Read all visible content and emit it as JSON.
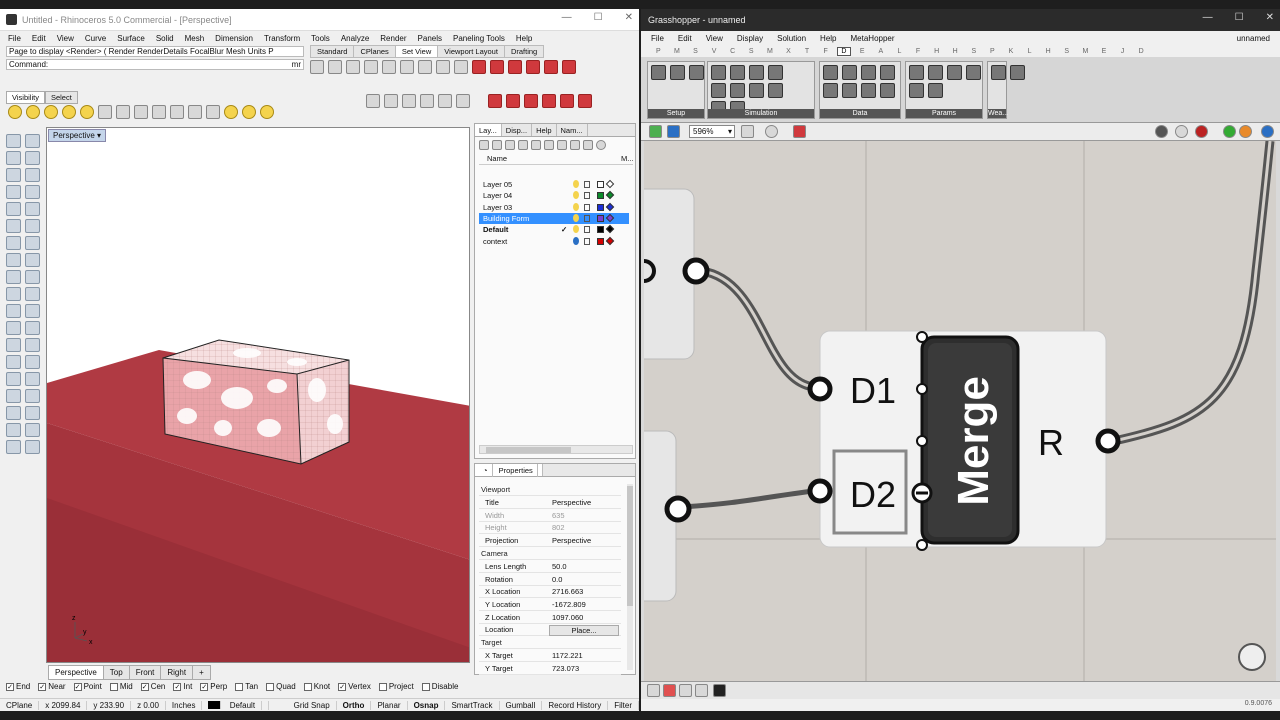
{
  "rhino": {
    "title": "Untitled - Rhinoceros 5.0 Commercial - [Perspective]",
    "menu": [
      "File",
      "Edit",
      "View",
      "Curve",
      "Surface",
      "Solid",
      "Mesh",
      "Dimension",
      "Transform",
      "Tools",
      "Analyze",
      "Render",
      "Panels",
      "Paneling Tools",
      "Help"
    ],
    "history_line": "Page to display <Render> ( Render  RenderDetails  FocalBlur  Mesh  Units  P",
    "command_label": "Command:",
    "command_suffix": "mr",
    "toolbar_tabs": [
      "Standard",
      "CPlanes",
      "Set View",
      "Viewport Layout",
      "Drafting"
    ],
    "toolbar_tab_active": "Set View",
    "left_tabs": [
      "Visibility",
      "Select"
    ],
    "viewport_label": "Perspective",
    "axis": {
      "z": "z",
      "y": "y",
      "x": "x"
    },
    "viewport_tabs": [
      "Perspective",
      "Top",
      "Front",
      "Right"
    ],
    "viewport_tab_add": "+",
    "layer_panel": {
      "tabs": [
        "Lay...",
        "Disp...",
        "Help",
        "Nam..."
      ],
      "column_name": "Name",
      "column_material": "M...",
      "layers": [
        {
          "name": "Layer 05",
          "color": "#ffffff",
          "selected": false,
          "current": false
        },
        {
          "name": "Layer 04",
          "color": "#0b8a2a",
          "selected": false,
          "current": false
        },
        {
          "name": "Layer 03",
          "color": "#1c2fd6",
          "selected": false,
          "current": false
        },
        {
          "name": "Building Form",
          "color": "#7a3fd0",
          "selected": true,
          "current": false
        },
        {
          "name": "Default",
          "color": "#000000",
          "selected": false,
          "current": true
        },
        {
          "name": "context",
          "color": "#d40000",
          "selected": false,
          "current": false
        }
      ],
      "current_mark": "✓"
    },
    "properties": {
      "title": "Properties",
      "section_viewport": "Viewport",
      "rows_viewport": [
        {
          "key": "Title",
          "value": "Perspective",
          "grey": false
        },
        {
          "key": "Width",
          "value": "635",
          "grey": true
        },
        {
          "key": "Height",
          "value": "802",
          "grey": true
        },
        {
          "key": "Projection",
          "value": "Perspective",
          "grey": false
        }
      ],
      "section_camera": "Camera",
      "rows_camera": [
        {
          "key": "Lens Length",
          "value": "50.0"
        },
        {
          "key": "Rotation",
          "value": "0.0"
        },
        {
          "key": "X Location",
          "value": "2716.663"
        },
        {
          "key": "Y Location",
          "value": "-1672.809"
        },
        {
          "key": "Z Location",
          "value": "1097.060"
        },
        {
          "key": "Location",
          "value": "Place..."
        }
      ],
      "section_target": "Target",
      "rows_target": [
        {
          "key": "X Target",
          "value": "1172.221"
        },
        {
          "key": "Y Target",
          "value": "723.073"
        }
      ]
    },
    "osnaps": [
      {
        "label": "End",
        "checked": true
      },
      {
        "label": "Near",
        "checked": true
      },
      {
        "label": "Point",
        "checked": true
      },
      {
        "label": "Mid",
        "checked": false
      },
      {
        "label": "Cen",
        "checked": true
      },
      {
        "label": "Int",
        "checked": true
      },
      {
        "label": "Perp",
        "checked": true
      },
      {
        "label": "Tan",
        "checked": false
      },
      {
        "label": "Quad",
        "checked": false
      },
      {
        "label": "Knot",
        "checked": false
      },
      {
        "label": "Vertex",
        "checked": true
      },
      {
        "label": "Project",
        "checked": false
      },
      {
        "label": "Disable",
        "checked": false
      }
    ],
    "status": {
      "cplane": "CPlane",
      "x": "x 2099.84",
      "y": "y 233.90",
      "z": "z 0.00",
      "units": "Inches",
      "layer": "Default",
      "toggles": [
        "Grid Snap",
        "Ortho",
        "Planar",
        "Osnap",
        "SmartTrack",
        "Gumball",
        "Record History",
        "Filter"
      ],
      "bold_toggles": [
        "Ortho",
        "Osnap"
      ]
    }
  },
  "gh": {
    "title": "Grasshopper - unnamed",
    "menu": [
      "File",
      "Edit",
      "View",
      "Display",
      "Solution",
      "Help",
      "MetaHopper"
    ],
    "doc_name": "unnamed",
    "tab_letters": [
      "P",
      "M",
      "S",
      "V",
      "C",
      "S",
      "M",
      "X",
      "T",
      "F",
      "D",
      "E",
      "A",
      "L",
      "F",
      "H",
      "H",
      "S",
      "P",
      "K",
      "L",
      "H",
      "S",
      "M",
      "E",
      "J",
      "D"
    ],
    "tab_letter_active_index": 10,
    "ribbon_groups": [
      "Setup",
      "Simulation",
      "Data",
      "Params",
      "Wea..."
    ],
    "zoom": "596%",
    "component": {
      "name": "Merge",
      "inputs": [
        "D1",
        "D2"
      ],
      "output": "R"
    },
    "version": "0.9.0076"
  }
}
